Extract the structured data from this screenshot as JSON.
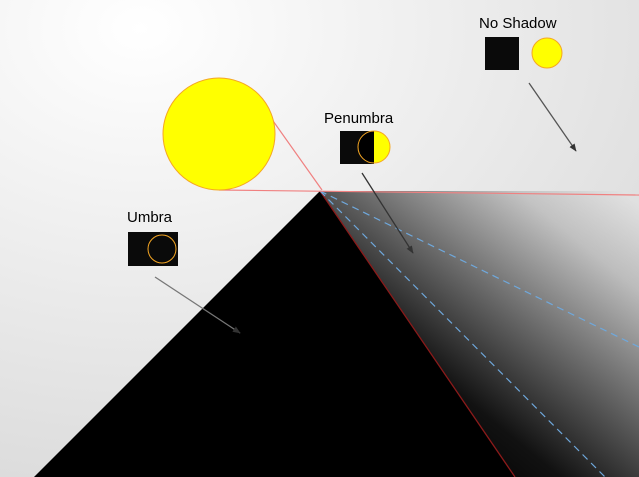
{
  "labels": {
    "no_shadow": "No Shadow",
    "penumbra": "Penumbra",
    "umbra": "Umbra"
  },
  "colors": {
    "sun_fill": "#ffff00",
    "sun_stroke": "#f5a623",
    "occluder": "#000000",
    "tangent_line": "#f08080",
    "umbra_boundary": "#8b1a1a",
    "penumbra_boundary": "#6fa8dc",
    "arrow": "#555555",
    "background_center": "#ffffff",
    "background_edge": "#d9d9d9"
  },
  "icons": {
    "sun": "sun-disc",
    "occluder": "black-square",
    "arrow": "arrow-pointer"
  }
}
